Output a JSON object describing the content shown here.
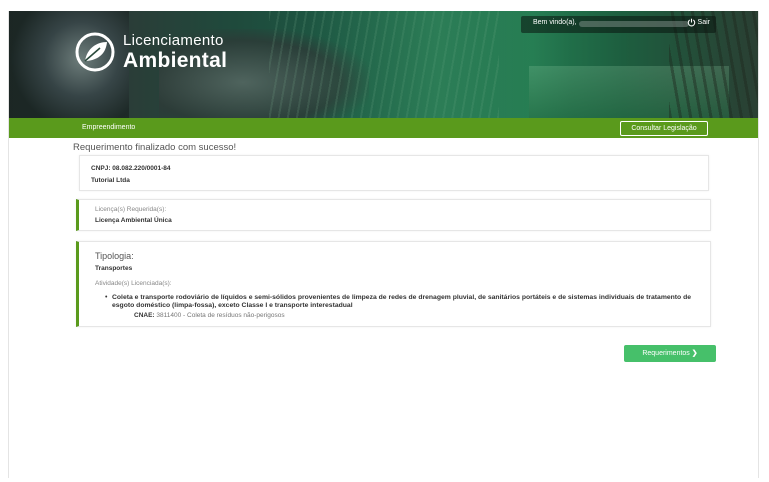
{
  "header": {
    "logo_line1": "Licenciamento",
    "logo_line2": "Ambiental",
    "welcome": "Bem vindo(a),",
    "logout_label": "Sair"
  },
  "nav": {
    "item": "Empreendimento",
    "legislation_button": "Consultar Legislação"
  },
  "main": {
    "success_message": "Requerimento finalizado com sucesso!",
    "company": {
      "cnpj": "CNPJ: 08.082.220/0001-84",
      "name": "Tutorial Ltda"
    },
    "license": {
      "label": "Licença(s) Requerida(s):",
      "value": "Licença Ambiental Única"
    },
    "typology": {
      "title": "Tipologia:",
      "value": "Transportes",
      "activities_label": "Atividade(s) Licenciada(s):",
      "activity": "Coleta e transporte rodoviário de líquidos e semi-sólidos provenientes de limpeza de redes de drenagem pluvial, de sanitários portáteis e de sistemas individuais de tratamento de esgoto doméstico (limpa-fossa), exceto Classe I e transporte interestadual",
      "cnae_label": "CNAE:",
      "cnae_value": "3811400 - Coleta de resíduos não-perigosos"
    },
    "requirements_button": "Requerimentos"
  },
  "colors": {
    "nav_green": "#5a9a1c",
    "button_green": "#46c06a"
  },
  "icons": {
    "logo": "leaf-circle-icon",
    "logout": "power-icon",
    "next": "chevron-right-icon"
  }
}
